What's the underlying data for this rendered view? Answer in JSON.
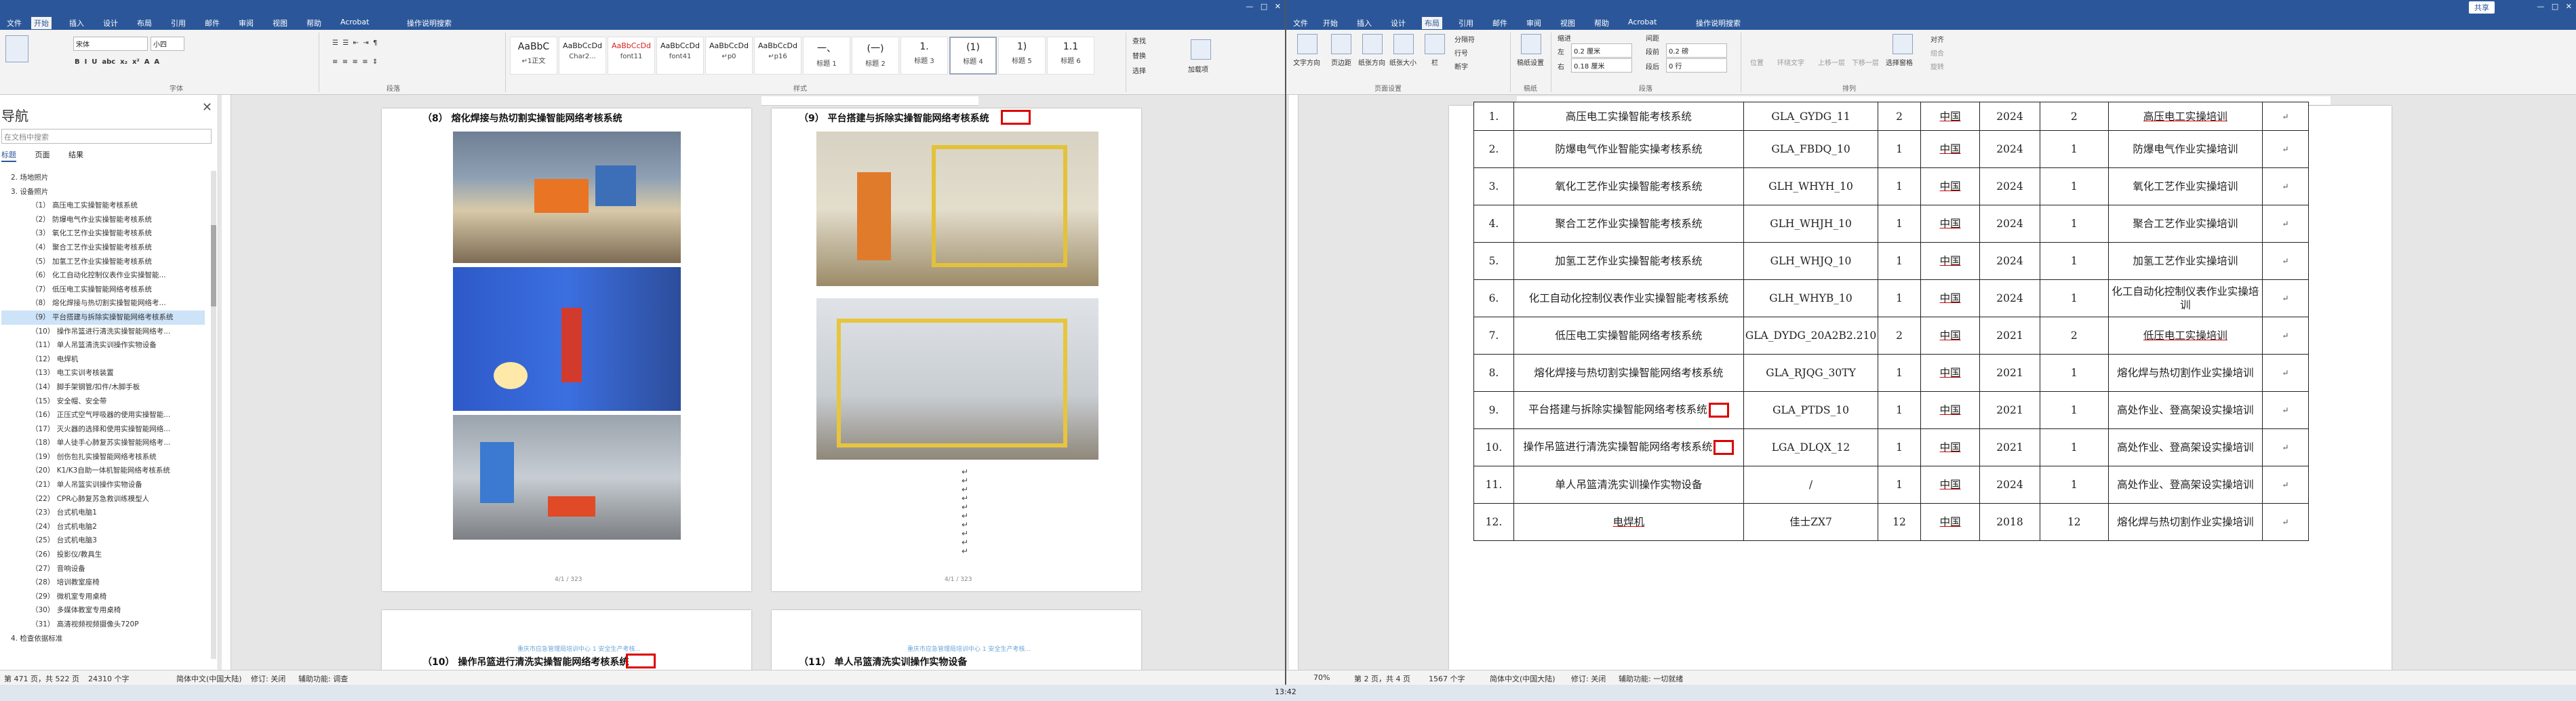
{
  "left_window": {
    "title": "",
    "tabs": [
      "文件",
      "开始",
      "插入",
      "设计",
      "布局",
      "引用",
      "邮件",
      "审阅",
      "视图",
      "帮助",
      "Acrobat",
      "操作说明搜索"
    ],
    "active_tab": "开始",
    "ribbon": {
      "font_name": "宋体",
      "font_size": "小四",
      "groups": [
        "字体",
        "段落",
        "样式"
      ],
      "styles": [
        {
          "sample": "AaBbC",
          "name": "↵1正文"
        },
        {
          "sample": "AaBbCcDd",
          "name": "Char2..."
        },
        {
          "sample": "AaBbCcDd",
          "name": "font11"
        },
        {
          "sample": "AaBbCcDd",
          "name": "font41"
        },
        {
          "sample": "AaBbCcDd",
          "name": "↵p0"
        },
        {
          "sample": "AaBbCcDd",
          "name": "↵p16"
        },
        {
          "sample": "一、",
          "name": "标题 1"
        },
        {
          "sample": "(一)",
          "name": "标题 2"
        },
        {
          "sample": "1.",
          "name": "标题 3"
        },
        {
          "sample": "(1)",
          "name": "标题 4"
        },
        {
          "sample": "1)",
          "name": "标题 5"
        },
        {
          "sample": "1.1",
          "name": "标题 6"
        }
      ],
      "edit_items": [
        "查找",
        "替换",
        "选择"
      ],
      "sign_label": "加载项"
    },
    "nav_pane": {
      "title": "导航",
      "search_placeholder": "在文档中搜索",
      "tabs": [
        "标题",
        "页面",
        "结果"
      ],
      "items": [
        "2. 场地照片",
        "3. 设备照片",
        "（1） 高压电工实操智能考核系统",
        "（2） 防爆电气作业实操智能考核系统",
        "（3） 氧化工艺作业实操智能考核系统",
        "（4） 聚合工艺作业实操智能考核系统",
        "（5） 加氢工艺作业实操智能考核系统",
        "（6） 化工自动化控制仪表作业实操智能...",
        "（7） 低压电工实操智能网络考核系统",
        "（8） 熔化焊接与热切割实操智能网络考...",
        "（9） 平台搭建与拆除实操智能网络考核系统",
        "（10） 操作吊篮进行清洗实操智能网络考...",
        "（11） 单人吊篮清洗实训操作实物设备",
        "（12） 电焊机",
        "（13） 电工实训考核装置",
        "（14） 脚手架钢管/扣件/木脚手板",
        "（15） 安全帽、安全带",
        "（16） 正压式空气呼吸器的使用实操智能...",
        "（17） 灭火器的选择和使用实操智能网络...",
        "（18） 单人徒手心肺复苏实操智能网络考...",
        "（19） 创伤包扎实操智能网络考核系统",
        "（20） K1/K3自助一体机智能网络考核系统",
        "（21） 单人吊篮实训操作实物设备",
        "（22） CPR心肺复苏急救训练模型人",
        "（23） 台式机电脑1",
        "（24） 台式机电脑2",
        "（25） 台式机电脑3",
        "（26） 投影仪/教具生",
        "（27） 音响设备",
        "（28） 培训教室座椅",
        "（29） 微机室专用桌椅",
        "（30） 多媒体教室专用桌椅",
        "（31） 高清视频视频摄像头720P",
        "4. 检查依据标准"
      ],
      "selected_index": 10
    },
    "pages": {
      "p1_heading": "（8） 熔化焊接与热切割实操智能网络考核系统",
      "p2_heading": "（9） 平台搭建与拆除实操智能网络考核系统",
      "p3_heading": "（10） 操作吊篮进行清洗实操智能网络考核系统",
      "p4_heading": "（11） 单人吊篮清洗实训操作实物设备",
      "p1_footer": "4/1 / 323",
      "p2_footer": "4/1 / 323",
      "p3_header": "重庆市应急管理局培训中心 1 安全生产考核...",
      "p4_header": "重庆市应急管理局培训中心 1 安全生产考核..."
    },
    "status": {
      "page": "第 471 页，共 522 页",
      "words": "24310 个字",
      "language": "简体中文(中国大陆)",
      "track": "修订: 关闭",
      "accessibility": "辅助功能: 调查"
    }
  },
  "right_window": {
    "tabs": [
      "文件",
      "开始",
      "插入",
      "设计",
      "布局",
      "引用",
      "邮件",
      "审阅",
      "视图",
      "帮助",
      "Acrobat",
      "操作说明搜索"
    ],
    "active_tab": "布局",
    "share": "共享",
    "ribbon": {
      "items": [
        "文字方向",
        "页边距",
        "纸张方向",
        "纸张大小",
        "栏",
        "分隔符",
        "行号",
        "断字",
        "稿纸设置",
        "缩进",
        "间距",
        "左",
        "右",
        "段前",
        "段后",
        "位置",
        "环绕文字",
        "上移一层",
        "下移一层",
        "选择窗格",
        "对齐",
        "组合",
        "旋转"
      ],
      "indent_left": "0.2 厘米",
      "indent_right": "0.18 厘米",
      "space_before": "0.2 磅",
      "space_after": "0 行",
      "groups": [
        "页面设置",
        "稿纸",
        "段落",
        "排列"
      ]
    },
    "table": {
      "rows": [
        [
          "1.",
          "高压电工实操智能考核系统",
          "GLA_GYDG_11",
          "2",
          "中国",
          "2024",
          "2",
          "高压电工实操培训"
        ],
        [
          "2.",
          "防爆电气作业智能实操考核系统",
          "GLA_FBDQ_10",
          "1",
          "中国",
          "2024",
          "1",
          "防爆电气作业实操培训"
        ],
        [
          "3.",
          "氧化工艺作业实操智能考核系统",
          "GLH_WHYH_10",
          "1",
          "中国",
          "2024",
          "1",
          "氧化工艺作业实操培训"
        ],
        [
          "4.",
          "聚合工艺作业实操智能考核系统",
          "GLH_WHJH_10",
          "1",
          "中国",
          "2024",
          "1",
          "聚合工艺作业实操培训"
        ],
        [
          "5.",
          "加氢工艺作业实操智能考核系统",
          "GLH_WHJQ_10",
          "1",
          "中国",
          "2024",
          "1",
          "加氢工艺作业实操培训"
        ],
        [
          "6.",
          "化工自动化控制仪表作业实操智能考核系统",
          "GLH_WHYB_10",
          "1",
          "中国",
          "2024",
          "1",
          "化工自动化控制仪表作业实操培训"
        ],
        [
          "7.",
          "低压电工实操智能网络考核系统",
          "GLA_DYDG_20A2B2.210",
          "2",
          "中国",
          "2021",
          "2",
          "低压电工实操培训"
        ],
        [
          "8.",
          "熔化焊接与热切割实操智能网络考核系统",
          "GLA_RJQG_30TY",
          "1",
          "中国",
          "2021",
          "1",
          "熔化焊与热切割作业实操培训"
        ],
        [
          "9.",
          "平台搭建与拆除实操智能网络考核系统",
          "GLA_PTDS_10",
          "1",
          "中国",
          "2021",
          "1",
          "高处作业、登高架设实操培训"
        ],
        [
          "10.",
          "操作吊篮进行清洗实操智能网络考核系统",
          "LGA_DLQX_12",
          "1",
          "中国",
          "2021",
          "1",
          "高处作业、登高架设实操培训"
        ],
        [
          "11.",
          "单人吊篮清洗实训操作实物设备",
          "/",
          "1",
          "中国",
          "2024",
          "1",
          "高处作业、登高架设实操培训"
        ],
        [
          "12.",
          "电焊机",
          "佳士ZX7",
          "12",
          "中国",
          "2018",
          "12",
          "熔化焊与热切割作业实操培训"
        ]
      ]
    },
    "status": {
      "page": "第 2 页，共 4 页",
      "words": "1567 个字",
      "language": "简体中文(中国大陆)",
      "track": "修订: 关闭",
      "accessibility": "辅助功能: 一切就绪",
      "zoom": "70%",
      "time": "13:42"
    }
  },
  "colors": {
    "accent": "#2b579a",
    "highlight": "#d00000"
  }
}
